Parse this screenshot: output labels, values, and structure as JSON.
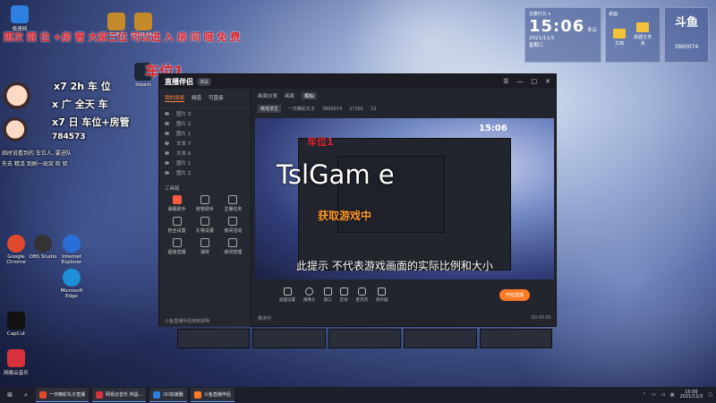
{
  "desktop_icons": [
    {
      "label": "极速网",
      "color": "#2d7fe0"
    },
    {
      "label": "PUBG",
      "color": "#c48a2a"
    },
    {
      "label": "PUBG Lite",
      "color": "#c48a2a"
    },
    {
      "label": "Steam",
      "color": "#1b2838"
    },
    {
      "label": "Microsoft Edge",
      "color": "#1e8fd8"
    },
    {
      "label": "Internet Explorer",
      "color": "#2a6fd8"
    },
    {
      "label": "Google Chrome",
      "color": "#e0492a"
    },
    {
      "label": "OBS Studio",
      "color": "#333"
    },
    {
      "label": "CapCut",
      "color": "#111"
    },
    {
      "label": "网易云音乐",
      "color": "#d8323c"
    }
  ],
  "overlay": {
    "top_red": "限次 限 位 +房 管 大家三位 可以进 入 房 间 哦 免 费",
    "car_tag": "车位1",
    "chat_lines": [
      "x7 2h 车 位",
      "x 广 全天 车",
      "x7 日 车位+房管",
      "784573",
      "临时说看到的 车位人..要进队",
      "先去 精活 到刷一局突 检 验"
    ],
    "preview_car": "车位1"
  },
  "clock_widget": {
    "header": "流量时长 ▾",
    "time": "15:06",
    "date": "2021/11/3",
    "weekday": "星期三",
    "weather": "多云"
  },
  "folder_widget": {
    "header": "桌面",
    "items": [
      "文档",
      "新建文件夹"
    ]
  },
  "room_widget": {
    "logo": "斗鱼",
    "room": "3860074"
  },
  "app": {
    "name": "直播伴侣",
    "version": "测试",
    "controls": [
      "☰",
      "—",
      "□",
      "✕"
    ],
    "left_tabs": [
      "我的场景",
      "频道",
      "可直接"
    ],
    "sources": [
      "图片 3",
      "图片 2",
      "图片 1",
      "文本 7",
      "文本 6",
      "图片 1",
      "图片 2"
    ],
    "tools_title": "工具箱",
    "tools": [
      "弹幕助手",
      "房管助手",
      "主播任务",
      "粉丝设置",
      "礼物设置",
      "房间活动",
      "超级直播",
      "抽奖",
      "房间管理",
      "私聊",
      "投票",
      "更多"
    ],
    "footer": "斗鱼直播伴侣使用说明",
    "right_tabs": [
      "画面仪表",
      "画面",
      "相似"
    ],
    "stats": {
      "category": "绝地求生",
      "room_name": "一日精彩丸子",
      "room_id": "3860074",
      "viewers": "17181",
      "fans": "12"
    },
    "preview_main_text": "TslGam  e",
    "preview_orange_text": "获取游戏中",
    "preview_subtitle": "此提示 不代表游戏画面的实际比例和大小",
    "preview_clock": "15:06",
    "bottom_buttons": [
      "画面设置",
      "摄像头",
      "窗口",
      "区域",
      "麦克风",
      "扬声器"
    ],
    "live_button": "开始直播",
    "status_left": "推流中",
    "status_right": "00:00:05"
  },
  "taskbar": {
    "start": "⊞",
    "search": "⌕",
    "apps": [
      {
        "label": "一日精彩丸子直播",
        "color": "#e0492a"
      },
      {
        "label": "网易云音乐 林昌...",
        "color": "#d8323c"
      },
      {
        "label": "UU加速器",
        "color": "#2d7fe0"
      },
      {
        "label": "斗鱼直播伴侣",
        "color": "#ff7a24"
      }
    ],
    "tray_lang": "英",
    "time": "15:06",
    "date": "2021/11/3"
  }
}
